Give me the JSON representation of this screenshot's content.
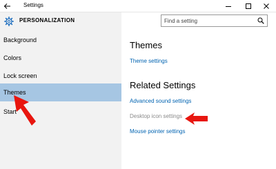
{
  "window": {
    "title": "Settings",
    "back_icon": "back-arrow-icon",
    "controls": [
      "minimize-icon",
      "maximize-icon",
      "close-icon"
    ]
  },
  "header": {
    "section_title": "PERSONALIZATION",
    "section_icon": "gear-icon",
    "search": {
      "placeholder": "Find a setting",
      "icon": "search-icon"
    }
  },
  "sidebar": {
    "items": [
      {
        "label": "Background",
        "selected": false
      },
      {
        "label": "Colors",
        "selected": false
      },
      {
        "label": "Lock screen",
        "selected": false
      },
      {
        "label": "Themes",
        "selected": true
      },
      {
        "label": "Start",
        "selected": false
      }
    ],
    "selected_color": "#a6c6e3",
    "background_color": "#f2f2f2"
  },
  "main": {
    "themes_heading": "Themes",
    "theme_settings_link": "Theme settings",
    "related_heading": "Related Settings",
    "related_links": [
      {
        "label": "Advanced sound settings",
        "enabled": true
      },
      {
        "label": "Desktop icon settings",
        "enabled": false
      },
      {
        "label": "Mouse pointer settings",
        "enabled": true
      }
    ],
    "link_color": "#0063b1"
  },
  "annotations": {
    "arrow_color": "#e8160f"
  }
}
